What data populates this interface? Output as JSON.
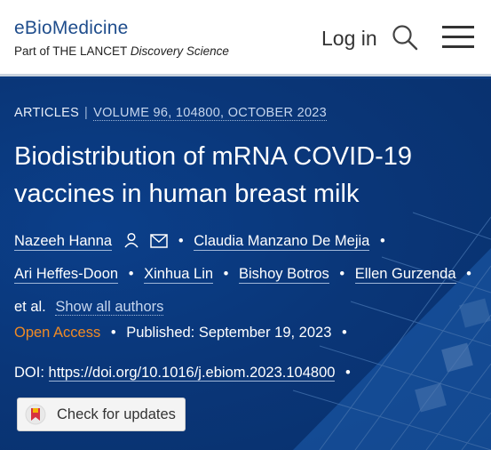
{
  "header": {
    "brand_name": "eBioMedicine",
    "brand_sub_prefix": "Part of THE LANCET",
    "brand_sub_italic": "Discovery Science",
    "login_label": "Log in"
  },
  "article": {
    "type_label": "ARTICLES",
    "volume_info": "VOLUME 96, 104800, OCTOBER 2023",
    "title": "Biodistribution of mRNA COVID-19 vaccines in human breast milk",
    "authors": [
      "Nazeeh Hanna",
      "Claudia Manzano De Mejia",
      "Ari Heffes-Doon",
      "Xinhua Lin",
      "Bishoy Botros",
      "Ellen Gurzenda"
    ],
    "et_al": "et al.",
    "show_all_label": "Show all authors",
    "open_access_label": "Open Access",
    "published_label": "Published:",
    "published_date": "September 19, 2023",
    "doi_label": "DOI:",
    "doi_link": "https://doi.org/10.1016/j.ebiom.2023.104800",
    "updates_label": "Check for updates"
  },
  "colors": {
    "accent_orange": "#f08a24",
    "hero_blue": "#0a3678",
    "brand_blue": "#1f4d8c"
  }
}
